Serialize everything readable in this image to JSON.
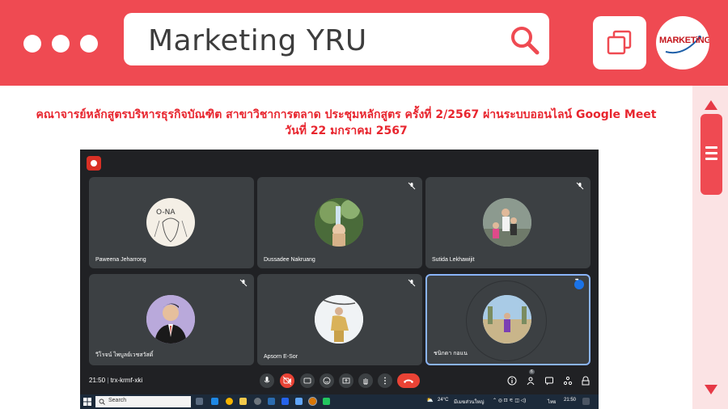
{
  "header": {
    "title": "Marketing YRU",
    "logo_text": "MARKETiNG",
    "accent_color": "#ef4a52",
    "search_icon": "search-icon",
    "copy_icon": "copy-icon"
  },
  "headline": {
    "line1": "คณาจารย์หลักสูตรบริหารธุรกิจบัณฑิต สาขาวิชาการตลาด ประชุมหลักสูตร ครั้งที่ 2/2567 ผ่านระบบออนไลน์ Google Meet",
    "line2": "วันที่ 22 มกราคม 2567"
  },
  "meet": {
    "participants": [
      {
        "name": "Paweena Jeharrong",
        "muted": false
      },
      {
        "name": "Dussadee Nakruang",
        "muted": true
      },
      {
        "name": "Sutida Lekhawijit",
        "muted": true
      },
      {
        "name": "วีโรจน์ ไพบูลย์เวชสวัสดิ์",
        "muted": true
      },
      {
        "name": "Apsorn E-Sor",
        "muted": true
      },
      {
        "name": "ชนิกดา กอแน",
        "muted": false,
        "active": true
      }
    ],
    "time": "21:50",
    "meeting_code": "trx-krmf-xki",
    "participant_count": "6"
  },
  "taskbar": {
    "search_placeholder": "Search",
    "weather": "24°C",
    "weather_desc": "มีเมฆส่วนใหญ่",
    "lang": "ไทย",
    "clock": "21:50"
  }
}
